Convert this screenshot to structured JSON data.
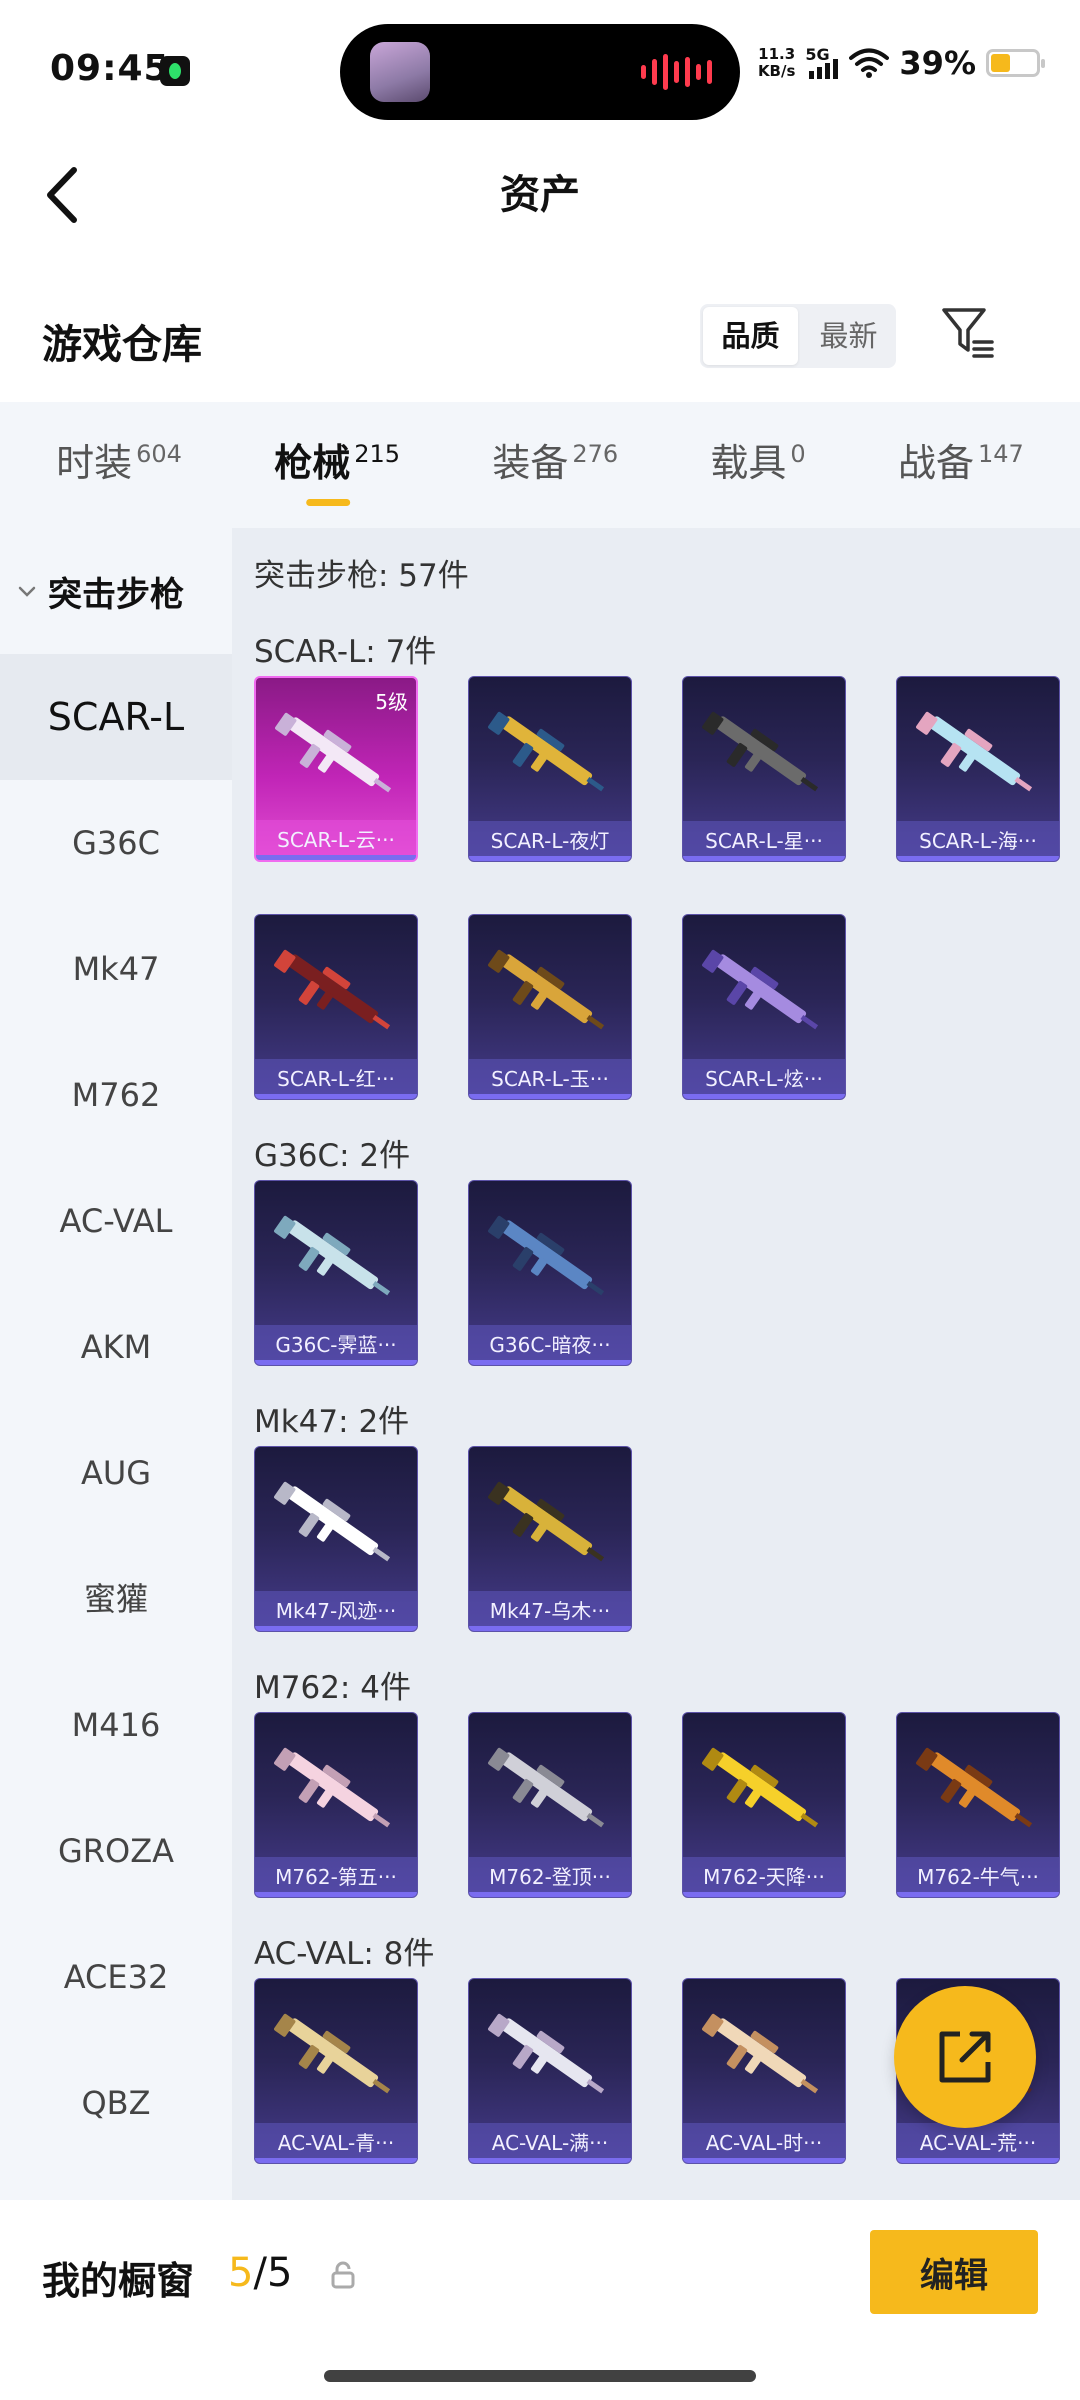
{
  "status": {
    "time": "09:45",
    "net_speed_value": "11.3",
    "net_speed_unit": "KB/s",
    "network": "5G",
    "battery": "39%"
  },
  "header": {
    "title": "资产"
  },
  "warehouse": {
    "title": "游戏仓库",
    "sort_options": [
      "品质",
      "最新"
    ],
    "active_sort": "品质"
  },
  "tabs": [
    {
      "label": "时装",
      "count": "604"
    },
    {
      "label": "枪械",
      "count": "215",
      "active": true
    },
    {
      "label": "装备",
      "count": "276"
    },
    {
      "label": "载具",
      "count": "0"
    },
    {
      "label": "战备",
      "count": "147"
    }
  ],
  "sidenav": {
    "group": "突击步枪",
    "items": [
      "SCAR-L",
      "G36C",
      "Mk47",
      "M762",
      "AC-VAL",
      "AKM",
      "AUG",
      "蜜獾",
      "M416",
      "GROZA",
      "ACE32",
      "QBZ"
    ],
    "active": "SCAR-L"
  },
  "content": {
    "summary": "突击步枪: 57件",
    "groups": [
      {
        "title": "SCAR-L: 7件",
        "items": [
          {
            "name": "SCAR-L-云···",
            "level": "5级",
            "rarity": "legendary"
          },
          {
            "name": "SCAR-L-夜灯"
          },
          {
            "name": "SCAR-L-星···"
          },
          {
            "name": "SCAR-L-海···"
          },
          {
            "name": "SCAR-L-红···"
          },
          {
            "name": "SCAR-L-玉···"
          },
          {
            "name": "SCAR-L-炫···"
          }
        ]
      },
      {
        "title": "G36C: 2件",
        "items": [
          {
            "name": "G36C-霁蓝···"
          },
          {
            "name": "G36C-暗夜···"
          }
        ]
      },
      {
        "title": "Mk47: 2件",
        "items": [
          {
            "name": "Mk47-风迹···"
          },
          {
            "name": "Mk47-乌木···"
          }
        ]
      },
      {
        "title": "M762: 4件",
        "items": [
          {
            "name": "M762-第五···"
          },
          {
            "name": "M762-登顶···"
          },
          {
            "name": "M762-天降···"
          },
          {
            "name": "M762-牛气···"
          }
        ]
      },
      {
        "title": "AC-VAL: 8件",
        "items": [
          {
            "name": "AC-VAL-青···"
          },
          {
            "name": "AC-VAL-满···"
          },
          {
            "name": "AC-VAL-时···"
          },
          {
            "name": "AC-VAL-荒···"
          }
        ]
      }
    ]
  },
  "bottom": {
    "window_label": "我的橱窗",
    "window_used": "5",
    "window_sep": "/",
    "window_total": "5",
    "edit_label": "编辑"
  },
  "colors": {
    "accent": "#f6b91c",
    "card_bg": "#2a2556",
    "legendary": "#c125b7"
  },
  "icons": {
    "back": "chevron-left-icon",
    "filter": "filter-icon",
    "share": "share-external-icon",
    "lock": "lock-icon"
  }
}
